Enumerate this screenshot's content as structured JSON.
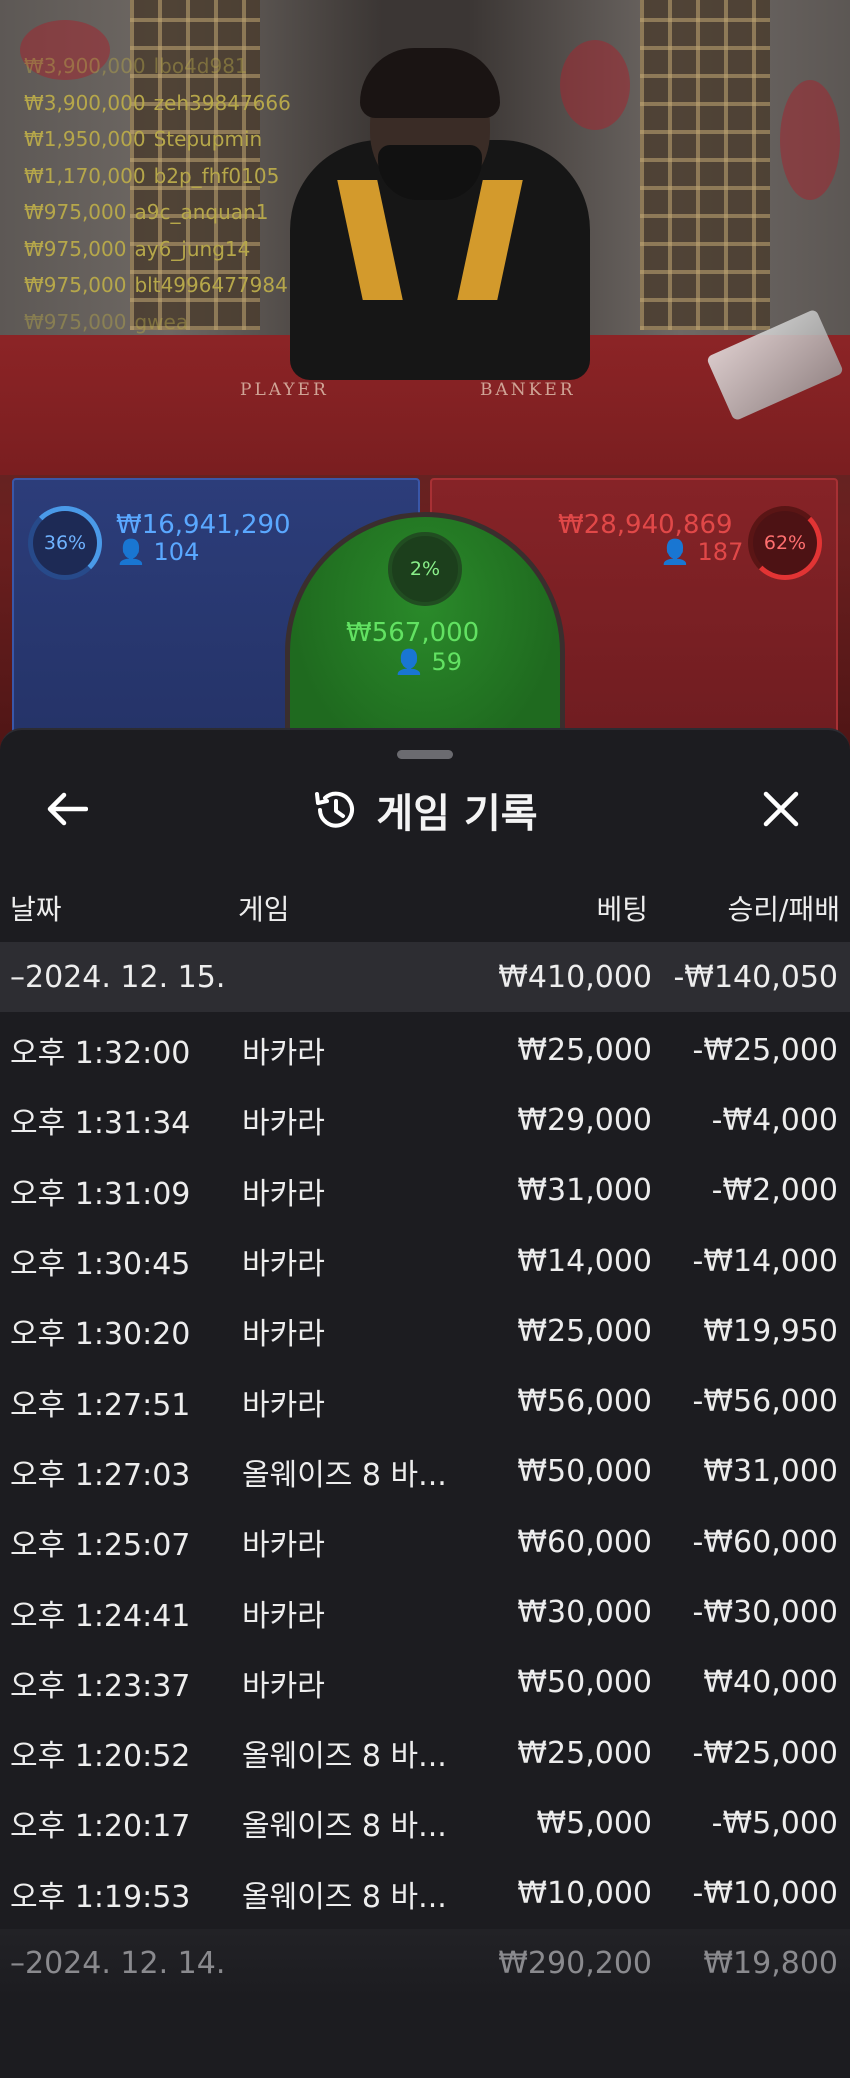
{
  "ticker": [
    {
      "amount": "₩3,900,000",
      "user": "lbo4d981"
    },
    {
      "amount": "₩3,900,000",
      "user": "zeh39847666"
    },
    {
      "amount": "₩1,950,000",
      "user": "Stepupmin"
    },
    {
      "amount": "₩1,170,000",
      "user": "b2p_fhf0105"
    },
    {
      "amount": "₩975,000",
      "user": "a9c_anquan1"
    },
    {
      "amount": "₩975,000",
      "user": "ay6_jung14"
    },
    {
      "amount": "₩975,000",
      "user": "blt4996477984"
    },
    {
      "amount": "₩975,000",
      "user": "gwea"
    }
  ],
  "table_labels": {
    "player": "PLAYER",
    "banker": "BANKER"
  },
  "bets": {
    "player": {
      "percent": "36%",
      "amount": "₩16,941,290",
      "count": "104",
      "color": "#4a9ae8"
    },
    "tie": {
      "percent": "2%",
      "amount": "₩567,000",
      "count": "59",
      "color": "#2a8a2a"
    },
    "banker": {
      "percent": "62%",
      "amount": "₩28,940,869",
      "count": "187",
      "color": "#e23434"
    }
  },
  "sheet": {
    "title": "게임 기록",
    "icons": {
      "back": "arrow-left-icon",
      "history": "history-icon",
      "close": "close-icon",
      "user": "user-icon"
    },
    "columns": {
      "date": "날짜",
      "game": "게임",
      "bet": "베팅",
      "result": "승리/패배"
    },
    "groups": [
      {
        "date": "–2024. 12. 15.",
        "bet_total": "₩410,000",
        "result_total": "-₩140,050",
        "rows": [
          {
            "time": "오후 1:32:00",
            "game": "바카라",
            "bet": "₩25,000",
            "result": "-₩25,000"
          },
          {
            "time": "오후 1:31:34",
            "game": "바카라",
            "bet": "₩29,000",
            "result": "-₩4,000"
          },
          {
            "time": "오후 1:31:09",
            "game": "바카라",
            "bet": "₩31,000",
            "result": "-₩2,000"
          },
          {
            "time": "오후 1:30:45",
            "game": "바카라",
            "bet": "₩14,000",
            "result": "-₩14,000"
          },
          {
            "time": "오후 1:30:20",
            "game": "바카라",
            "bet": "₩25,000",
            "result": "₩19,950"
          },
          {
            "time": "오후 1:27:51",
            "game": "바카라",
            "bet": "₩56,000",
            "result": "-₩56,000"
          },
          {
            "time": "오후 1:27:03",
            "game": "올웨이즈 8 바...",
            "bet": "₩50,000",
            "result": "₩31,000"
          },
          {
            "time": "오후 1:25:07",
            "game": "바카라",
            "bet": "₩60,000",
            "result": "-₩60,000"
          },
          {
            "time": "오후 1:24:41",
            "game": "바카라",
            "bet": "₩30,000",
            "result": "-₩30,000"
          },
          {
            "time": "오후 1:23:37",
            "game": "바카라",
            "bet": "₩50,000",
            "result": "₩40,000"
          },
          {
            "time": "오후 1:20:52",
            "game": "올웨이즈 8 바...",
            "bet": "₩25,000",
            "result": "-₩25,000"
          },
          {
            "time": "오후 1:20:17",
            "game": "올웨이즈 8 바...",
            "bet": "₩5,000",
            "result": "-₩5,000"
          },
          {
            "time": "오후 1:19:53",
            "game": "올웨이즈 8 바...",
            "bet": "₩10,000",
            "result": "-₩10,000"
          }
        ]
      },
      {
        "date": "–2024. 12. 14.",
        "bet_total": "₩290,200",
        "result_total": "₩19,800",
        "rows": []
      }
    ]
  }
}
